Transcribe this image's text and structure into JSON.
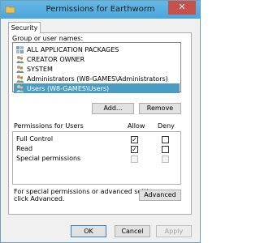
{
  "window": {
    "title": "Permissions for Earthworm",
    "close_glyph": "✕"
  },
  "tabs": [
    {
      "label": "Security"
    }
  ],
  "group_section": {
    "label": "Group or user names:",
    "items": [
      {
        "label": "ALL APPLICATION PACKAGES",
        "icon": "app-packages-icon",
        "selected": false
      },
      {
        "label": "CREATOR OWNER",
        "icon": "users-icon",
        "selected": false
      },
      {
        "label": "SYSTEM",
        "icon": "users-icon",
        "selected": false
      },
      {
        "label": "Administrators (W8-GAMES\\Administrators)",
        "icon": "users-icon",
        "selected": false
      },
      {
        "label": "Users (W8-GAMES\\Users)",
        "icon": "users-icon",
        "selected": true
      }
    ],
    "add_label": "Add...",
    "remove_label": "Remove"
  },
  "permissions": {
    "header": "Permissions for Users",
    "allow_label": "Allow",
    "deny_label": "Deny",
    "rows": [
      {
        "label": "Full Control",
        "allow": true,
        "deny": false,
        "enabled": true
      },
      {
        "label": "Read",
        "allow": true,
        "deny": false,
        "enabled": true
      },
      {
        "label": "Special permissions",
        "allow": false,
        "deny": false,
        "enabled": false
      }
    ]
  },
  "advanced": {
    "text_line1": "For special permissions or advanced settings,",
    "text_line2": "click Advanced.",
    "button_label": "Advanced"
  },
  "footer": {
    "ok_label": "OK",
    "cancel_label": "Cancel",
    "apply_label": "Apply"
  },
  "colors": {
    "selection": "#4a9cc4",
    "titlebar": "#5aaee0",
    "close": "#c7504b"
  }
}
